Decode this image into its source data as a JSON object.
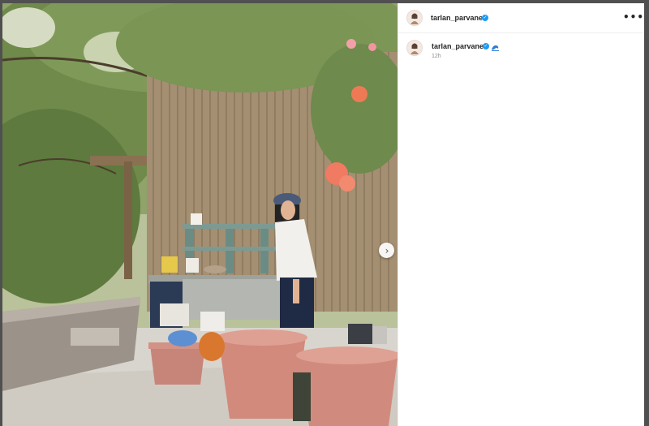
{
  "post": {
    "author_username": "tarlan_parvanee",
    "caption_emoji": "wave-emoji",
    "timestamp": "12h",
    "more_icon": "•••",
    "next_icon": "›"
  },
  "colors": {
    "verified_badge": "#1d9bf0",
    "panel_bg": "#ffffff",
    "muted_text": "#8e8e8e",
    "username_text": "#262626"
  }
}
